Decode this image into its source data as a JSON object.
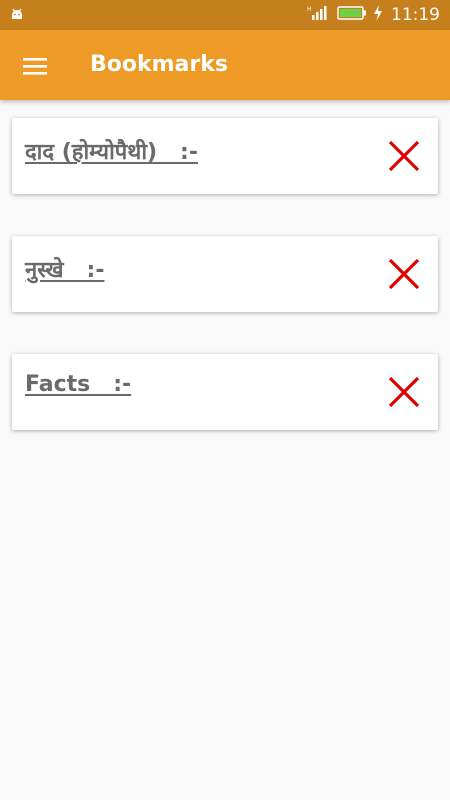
{
  "status_bar": {
    "time": "11:19",
    "icons": [
      "android-icon",
      "signal-icon",
      "battery-icon",
      "charging-icon"
    ],
    "colors": {
      "background": "#c57f1c",
      "battery_fill": "#6dd146"
    }
  },
  "app_bar": {
    "title": "Bookmarks",
    "menu_icon": "hamburger-menu-icon",
    "colors": {
      "background": "#ee9a27",
      "text": "#ffffff"
    }
  },
  "bookmarks": [
    {
      "title": "दाद (होम्योपैथी)   :-",
      "delete_icon": "close-icon"
    },
    {
      "title": "नुस्खे   :-",
      "delete_icon": "close-icon"
    },
    {
      "title": "Facts   :-",
      "delete_icon": "close-icon"
    }
  ],
  "colors": {
    "page_background": "#f9f9f9",
    "card_background": "#ffffff",
    "card_text": "#6a6a6a",
    "delete_icon": "#e00000"
  }
}
